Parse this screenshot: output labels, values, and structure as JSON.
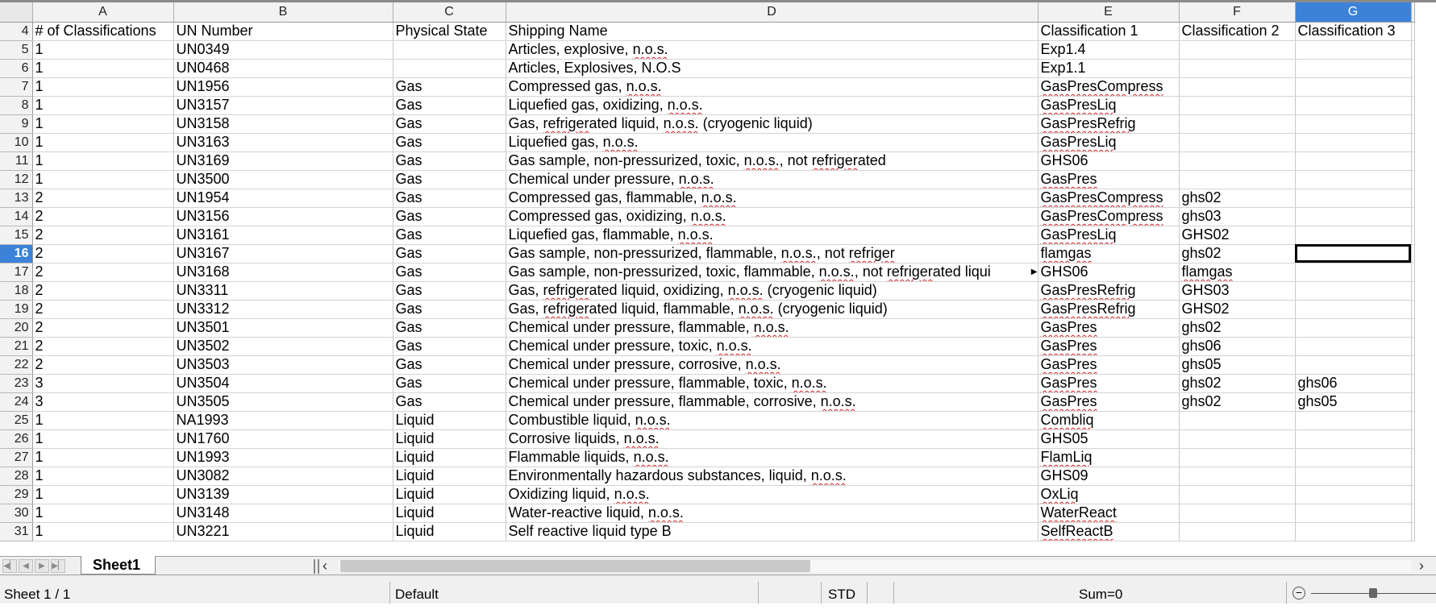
{
  "grid": {
    "columns": [
      "A",
      "B",
      "C",
      "D",
      "E",
      "F",
      "G"
    ],
    "selected_column": "G",
    "active_row": 16,
    "rows": [
      {
        "n": "4",
        "cells": [
          "# of Classifications",
          "UN Number",
          "Physical State",
          "Shipping Name",
          "Classification 1",
          "Classification 2",
          "Classification 3"
        ]
      },
      {
        "n": "5",
        "cells": [
          "1",
          "UN0349",
          "",
          "Articles, explosive, n.o.s.",
          "Exp1.4",
          "",
          ""
        ]
      },
      {
        "n": "6",
        "cells": [
          "1",
          "UN0468",
          "",
          "Articles, Explosives, N.O.S",
          "Exp1.1",
          "",
          ""
        ]
      },
      {
        "n": "7",
        "cells": [
          "1",
          "UN1956",
          "Gas",
          "Compressed gas, n.o.s.",
          "GasPresCompress",
          "",
          ""
        ]
      },
      {
        "n": "8",
        "cells": [
          "1",
          "UN3157",
          "Gas",
          "Liquefied gas, oxidizing, n.o.s.",
          "GasPresLiq",
          "",
          ""
        ]
      },
      {
        "n": "9",
        "cells": [
          "1",
          "UN3158",
          "Gas",
          "Gas, refrigerated liquid, n.o.s. (cryogenic liquid)",
          "GasPresRefrig",
          "",
          ""
        ]
      },
      {
        "n": "10",
        "cells": [
          "1",
          "UN3163",
          "Gas",
          "Liquefied gas, n.o.s.",
          "GasPresLiq",
          "",
          ""
        ]
      },
      {
        "n": "11",
        "cells": [
          "1",
          "UN3169",
          "Gas",
          "Gas sample, non-pressurized, toxic, n.o.s., not refrigerated",
          "GHS06",
          "",
          ""
        ]
      },
      {
        "n": "12",
        "cells": [
          "1",
          "UN3500",
          "Gas",
          "Chemical under pressure, n.o.s.",
          "GasPres",
          "",
          ""
        ]
      },
      {
        "n": "13",
        "cells": [
          "2",
          "UN1954",
          "Gas",
          "Compressed gas, flammable, n.o.s.",
          "GasPresCompress",
          "ghs02",
          ""
        ]
      },
      {
        "n": "14",
        "cells": [
          "2",
          "UN3156",
          "Gas",
          "Compressed gas, oxidizing, n.o.s.",
          "GasPresCompress",
          "ghs03",
          ""
        ]
      },
      {
        "n": "15",
        "cells": [
          "2",
          "UN3161",
          "Gas",
          "Liquefied gas, flammable, n.o.s.",
          "GasPresLiq",
          "GHS02",
          ""
        ]
      },
      {
        "n": "16",
        "cells": [
          "2",
          "UN3167",
          "Gas",
          "Gas sample, non-pressurized, flammable, n.o.s., not refriger",
          "flamgas",
          "ghs02",
          ""
        ]
      },
      {
        "n": "17",
        "cells": [
          "2",
          "UN3168",
          "Gas",
          "Gas sample, non-pressurized, toxic, flammable, n.o.s., not refrigerated liqui",
          "GHS06",
          "flamgas",
          ""
        ]
      },
      {
        "n": "18",
        "cells": [
          "2",
          "UN3311",
          "Gas",
          "Gas, refrigerated liquid, oxidizing, n.o.s. (cryogenic liquid)",
          "GasPresRefrig",
          "GHS03",
          ""
        ]
      },
      {
        "n": "19",
        "cells": [
          "2",
          "UN3312",
          "Gas",
          "Gas, refrigerated liquid, flammable, n.o.s. (cryogenic liquid)",
          "GasPresRefrig",
          "GHS02",
          ""
        ]
      },
      {
        "n": "20",
        "cells": [
          "2",
          "UN3501",
          "Gas",
          "Chemical under pressure, flammable, n.o.s.",
          "GasPres",
          "ghs02",
          ""
        ]
      },
      {
        "n": "21",
        "cells": [
          "2",
          "UN3502",
          "Gas",
          "Chemical under pressure, toxic, n.o.s.",
          "GasPres",
          "ghs06",
          ""
        ]
      },
      {
        "n": "22",
        "cells": [
          "2",
          "UN3503",
          "Gas",
          "Chemical under pressure, corrosive, n.o.s.",
          "GasPres",
          "ghs05",
          ""
        ]
      },
      {
        "n": "23",
        "cells": [
          "3",
          "UN3504",
          "Gas",
          "Chemical under pressure, flammable, toxic, n.o.s.",
          "GasPres",
          "ghs02",
          "ghs06"
        ]
      },
      {
        "n": "24",
        "cells": [
          "3",
          "UN3505",
          "Gas",
          "Chemical under pressure, flammable, corrosive, n.o.s.",
          "GasPres",
          "ghs02",
          "ghs05"
        ]
      },
      {
        "n": "25",
        "cells": [
          "1",
          "NA1993",
          "Liquid",
          "Combustible liquid, n.o.s.",
          "Combliq",
          "",
          ""
        ]
      },
      {
        "n": "26",
        "cells": [
          "1",
          "UN1760",
          "Liquid",
          "Corrosive liquids, n.o.s.",
          "GHS05",
          "",
          ""
        ]
      },
      {
        "n": "27",
        "cells": [
          "1",
          "UN1993",
          "Liquid",
          "Flammable liquids, n.o.s.",
          "FlamLiq",
          "",
          ""
        ]
      },
      {
        "n": "28",
        "cells": [
          "1",
          "UN3082",
          "Liquid",
          "Environmentally hazardous substances, liquid, n.o.s.",
          "GHS09",
          "",
          ""
        ]
      },
      {
        "n": "29",
        "cells": [
          "1",
          "UN3139",
          "Liquid",
          "Oxidizing liquid, n.o.s.",
          "OxLiq",
          "",
          ""
        ]
      },
      {
        "n": "30",
        "cells": [
          "1",
          "UN3148",
          "Liquid",
          "Water-reactive liquid, n.o.s.",
          "WaterReact",
          "",
          ""
        ]
      },
      {
        "n": "31",
        "cells": [
          "1",
          "UN3221",
          "Liquid",
          "Self reactive liquid type B",
          "SelfReactB",
          "",
          ""
        ]
      }
    ]
  },
  "tabs": {
    "nav_icons": [
      "first-sheet-icon",
      "prev-sheet-icon",
      "next-sheet-icon",
      "last-sheet-icon"
    ],
    "sheet_name": "Sheet1"
  },
  "status": {
    "sheet_position": "Sheet 1 / 1",
    "page_style": "Default",
    "selection_mode": "STD",
    "sum": "Sum=0",
    "zoom_icon": "zoom-out-icon"
  }
}
